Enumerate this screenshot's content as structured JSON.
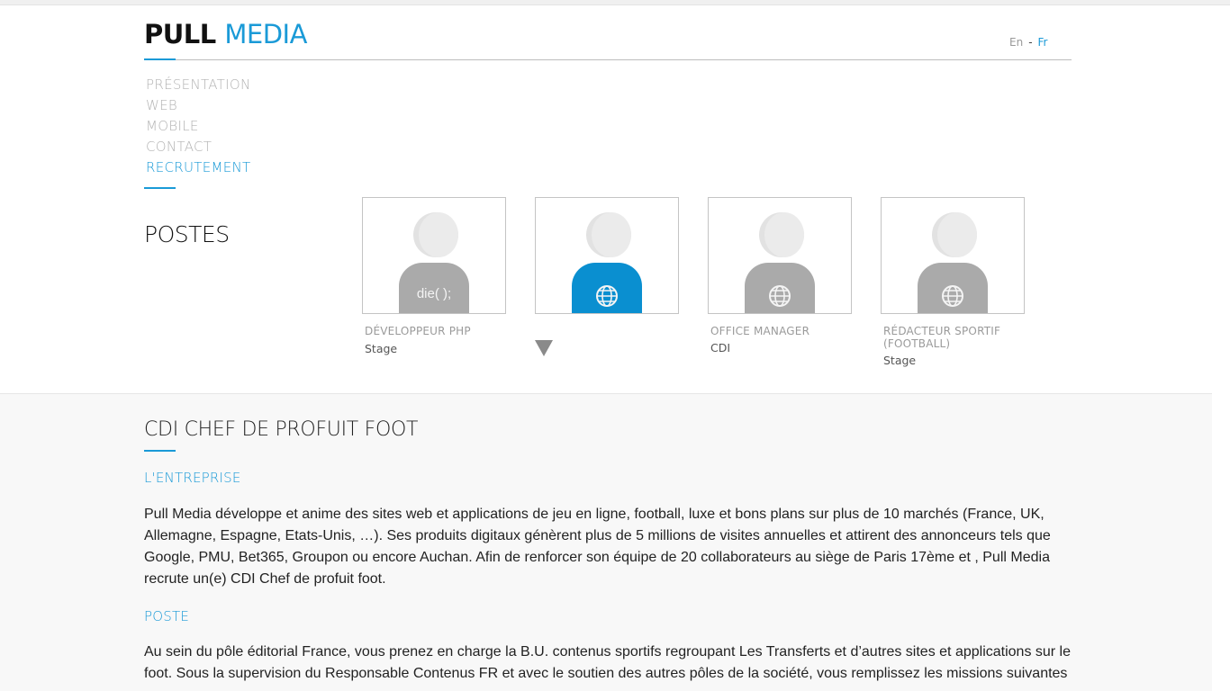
{
  "header": {
    "logo_part1": "PULL",
    "logo_part2": "MEDIA",
    "lang_en": "En",
    "lang_sep": "-",
    "lang_fr": "Fr"
  },
  "nav": {
    "items": [
      {
        "label": "PRÉSENTATION"
      },
      {
        "label": "WEB"
      },
      {
        "label": "MOBILE"
      },
      {
        "label": "CONTACT"
      },
      {
        "label": "RECRUTEMENT"
      }
    ]
  },
  "postes": {
    "title": "POSTES",
    "cards": [
      {
        "title": "DÉVELOPPEUR PHP",
        "type": "Stage",
        "avatar_text": "die( );",
        "icon": "php-die-text"
      },
      {
        "title": "",
        "type": "",
        "avatar_text": "",
        "icon": "globe-icon",
        "selected": true
      },
      {
        "title": "OFFICE MANAGER",
        "type": "CDI",
        "avatar_text": "",
        "icon": "globe-icon"
      },
      {
        "title": "RÉDACTEUR SPORTIF (FOOTBALL)",
        "type": "Stage",
        "avatar_text": "",
        "icon": "globe-icon"
      }
    ]
  },
  "detail": {
    "title": "CDI CHEF DE PROFUIT FOOT",
    "section1_heading": "L'ENTREPRISE",
    "section1_text": "Pull Media développe et anime des sites web et applications de jeu en ligne, football, luxe et bons plans sur plus de 10 marchés (France, UK, Allemagne, Espagne, Etats-Unis, …). Ses produits digitaux génèrent plus de 5 millions de visites annuelles et attirent des annonceurs tels que Google, PMU, Bet365, Groupon ou encore Auchan. Afin de renforcer son équipe de 20 collaborateurs au siège de Paris 17ème et , Pull Media recrute un(e) CDI Chef de profuit foot.",
    "section2_heading": "POSTE",
    "section2_text": "Au sein du pôle éditorial France, vous prenez en charge la B.U. contenus sportifs regroupant Les Transferts et d’autres sites et applications sur le foot. Sous la supervision du Responsable Contenus FR et avec le soutien des autres pôles de la société, vous remplissez les missions suivantes"
  },
  "colors": {
    "accent": "#1a9ad7",
    "selected_avatar": "#0a8fd0",
    "avatar_body": "#aaaaaa"
  }
}
